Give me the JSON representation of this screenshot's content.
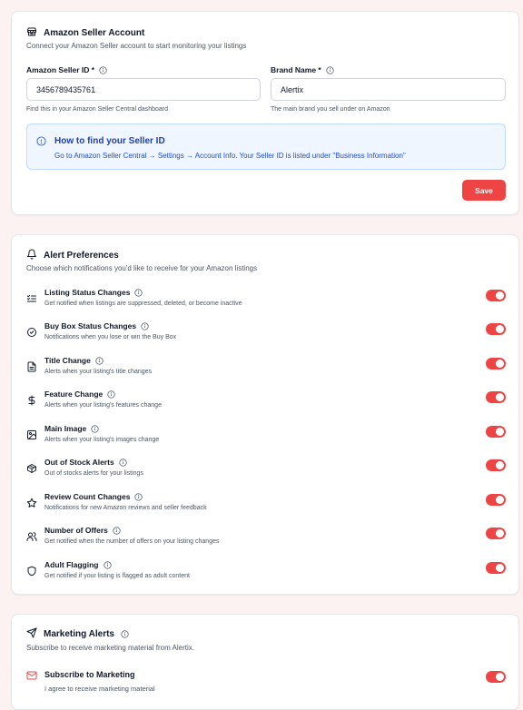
{
  "seller": {
    "title": "Amazon Seller Account",
    "subtitle": "Connect your Amazon Seller account to start monitoring your listings",
    "seller_id_label": "Amazon Seller ID *",
    "seller_id_value": "3456789435761",
    "seller_id_help": "Find this in your Amazon Seller Central dashboard",
    "brand_label": "Brand Name *",
    "brand_value": "Alertix",
    "brand_help": "The main brand you sell under on Amazon",
    "info_title": "How to find your Seller ID",
    "info_text": "Go to Amazon Seller Central → Settings → Account Info. Your Seller ID is listed under \"Business Information\"",
    "save_label": "Save"
  },
  "alerts": {
    "title": "Alert Preferences",
    "subtitle": "Choose which notifications you'd like to receive for your Amazon listings",
    "items": [
      {
        "title": "Listing Status Changes",
        "desc": "Get notified when listings are suppressed, deleted, or become inactive",
        "icon": "list-check-icon",
        "enabled": true
      },
      {
        "title": "Buy Box Status Changes",
        "desc": "Notifications when you lose or win the Buy Box",
        "icon": "check-circle-icon",
        "enabled": true
      },
      {
        "title": "Title Change",
        "desc": "Alerts when your listing's title changes",
        "icon": "document-icon",
        "enabled": true
      },
      {
        "title": "Feature Change",
        "desc": "Alerts when your listing's features change",
        "icon": "dollar-icon",
        "enabled": true
      },
      {
        "title": "Main Image",
        "desc": "Alerts when your listing's images change",
        "icon": "image-icon",
        "enabled": true
      },
      {
        "title": "Out of Stock Alerts",
        "desc": "Out of stocks alerts for your listings",
        "icon": "package-icon",
        "enabled": true
      },
      {
        "title": "Review Count Changes",
        "desc": "Notifications for new Amazon reviews and seller feedback",
        "icon": "star-icon",
        "enabled": true
      },
      {
        "title": "Number of Offers",
        "desc": "Get notified when the number of offers on your listing changes",
        "icon": "users-icon",
        "enabled": true
      },
      {
        "title": "Adult Flagging",
        "desc": "Get notified if your listing is flagged as adult content",
        "icon": "shield-icon",
        "enabled": true
      }
    ]
  },
  "marketing": {
    "title": "Marketing Alerts",
    "subtitle": "Subscribe to receive marketing material from Alertix.",
    "item_title": "Subscribe to Marketing",
    "item_desc": "I agree to receive marketing material",
    "enabled": true
  },
  "colors": {
    "accent": "#ef4444",
    "info_bg": "#eff6ff",
    "info_text": "#1d4ed8",
    "page_bg": "#fdf2f2"
  }
}
